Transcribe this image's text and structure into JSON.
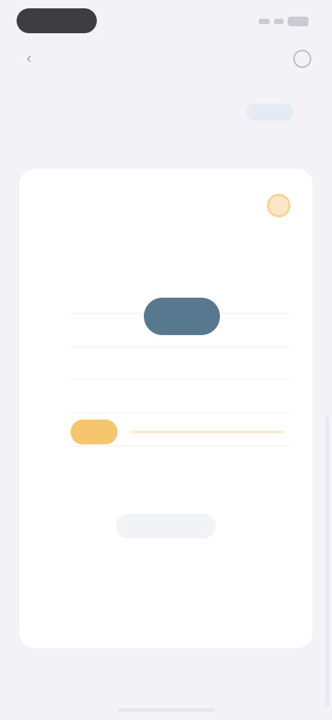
{
  "nav": {
    "title": "",
    "back_icon": "chevron-left-icon",
    "more_icon": "more-circle-icon"
  },
  "tabs": [
    {
      "label": ""
    },
    {
      "label": ""
    }
  ],
  "card": {
    "title": "",
    "icon": "sun-icon",
    "subtabs": [
      {
        "label": ""
      },
      {
        "label": ""
      },
      {
        "label": ""
      }
    ],
    "chart": {
      "y_labels": [
        "",
        "",
        "",
        "",
        "",
        ""
      ],
      "x_labels": [
        "",
        "",
        "",
        "",
        ""
      ]
    },
    "detail_button": "",
    "summary": {
      "label": "",
      "value": ""
    }
  },
  "colors": {
    "background": "#f3f3f7",
    "accent_blue": "#57788f",
    "accent_yellow": "#f6c66e",
    "active_tab_bg": "#e4ebf5"
  }
}
